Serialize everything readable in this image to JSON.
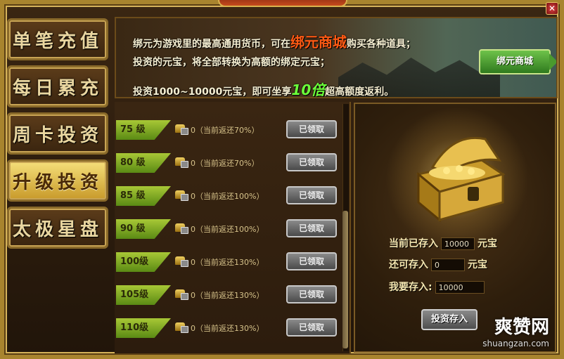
{
  "sidebar": {
    "items": [
      {
        "label": "单笔充值"
      },
      {
        "label": "每日累充"
      },
      {
        "label": "周卡投资"
      },
      {
        "label": "升级投资",
        "active": true
      },
      {
        "label": "太极星盘"
      }
    ]
  },
  "banner": {
    "line1_pre": "绑元为游戏里的最高通用货币，可在",
    "line1_highlight": "绑元商城",
    "line1_post": "购买各种道具；",
    "line2": "投资的元宝，将全部转换为高额的绑定元宝；",
    "line3_pre": "投资1000~10000元宝，即可坐享",
    "line3_highlight": "10倍",
    "line3_post": "超高额度返利。",
    "shop_button": "绑元商城"
  },
  "rows": [
    {
      "level": "75  级",
      "text": "0（当前返还70%）",
      "button": "已领取"
    },
    {
      "level": "80  级",
      "text": "0（当前返还70%）",
      "button": "已领取"
    },
    {
      "level": "85  级",
      "text": "0（当前返还100%）",
      "button": "已领取"
    },
    {
      "level": "90  级",
      "text": "0（当前返还100%）",
      "button": "已领取"
    },
    {
      "level": "100级",
      "text": "0（当前返还130%）",
      "button": "已领取"
    },
    {
      "level": "105级",
      "text": "0（当前返还130%）",
      "button": "已领取"
    },
    {
      "level": "110级",
      "text": "0（当前返还130%）",
      "button": "已领取"
    }
  ],
  "invest": {
    "deposited_label": "当前已存入",
    "deposited_value": "10000",
    "remaining_label": "还可存入",
    "remaining_value": "0",
    "unit": "元宝",
    "input_label": "我要存入:",
    "input_value": "10000",
    "button": "投资存入"
  },
  "watermark": {
    "name": "爽赞网",
    "url": "shuangzan.com"
  },
  "icons": {
    "close": "close-icon",
    "ingot": "ingot-icon",
    "lock": "lock-icon",
    "chest": "treasure-chest-icon"
  }
}
